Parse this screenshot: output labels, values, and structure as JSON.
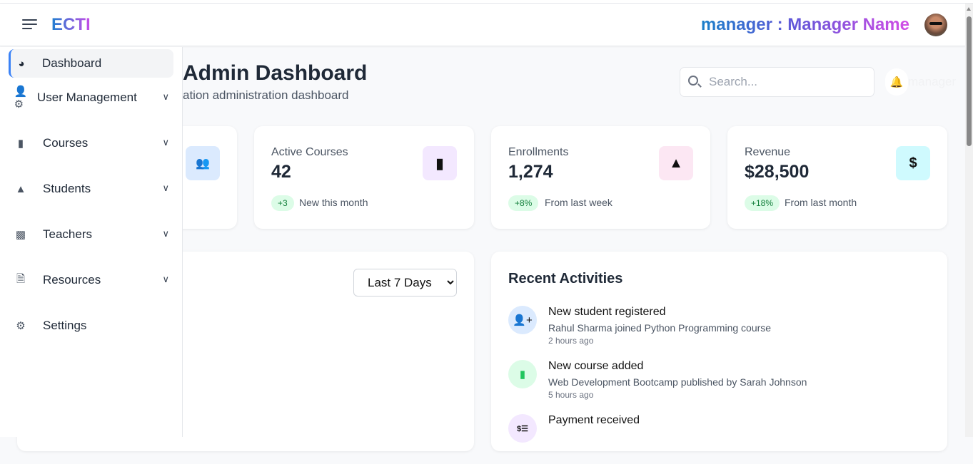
{
  "header": {
    "logo": "ECTI",
    "user_label": "manager : Manager Name"
  },
  "sidebar": {
    "items": [
      {
        "label": "Dashboard",
        "icon": "gauge-icon",
        "active": true
      },
      {
        "label": "User Management",
        "icon": "user-gear-icon",
        "expandable": true
      },
      {
        "label": "Courses",
        "icon": "book-icon",
        "expandable": true
      },
      {
        "label": "Students",
        "icon": "graduate-icon",
        "expandable": true
      },
      {
        "label": "Teachers",
        "icon": "chalkboard-teacher-icon",
        "expandable": true
      },
      {
        "label": "Resources",
        "icon": "file-icon",
        "expandable": true
      },
      {
        "label": "Settings",
        "icon": "gear-icon"
      }
    ]
  },
  "page": {
    "title": "Admin Dashboard",
    "subtitle": "ation administration dashboard",
    "ghost_text": "manager"
  },
  "search": {
    "placeholder": "Search..."
  },
  "stats": [
    {
      "label": "Active Courses",
      "value": "42",
      "badge": "+3",
      "note": "New this month",
      "icon": "book-icon",
      "color": "#f3e8ff"
    },
    {
      "label": "Enrollments",
      "value": "1,274",
      "badge": "+8%",
      "note": "From last week",
      "icon": "graduate-icon",
      "color": "#fce7f3"
    },
    {
      "label": "Revenue",
      "value": "$28,500",
      "badge": "+18%",
      "note": "From last month",
      "icon": "dollar-icon",
      "color": "#cffafe"
    }
  ],
  "chart_panel": {
    "range_selected": "Last 7 Days"
  },
  "activities": {
    "title": "Recent Activities",
    "items": [
      {
        "title": "New student registered",
        "desc": "Rahul Sharma joined Python Programming course",
        "time": "2 hours ago",
        "icon": "user-plus-icon"
      },
      {
        "title": "New course added",
        "desc": "Web Development Bootcamp published by Sarah Johnson",
        "time": "5 hours ago",
        "icon": "book-icon"
      },
      {
        "title": "Payment received",
        "icon": "money-check-icon"
      }
    ]
  }
}
